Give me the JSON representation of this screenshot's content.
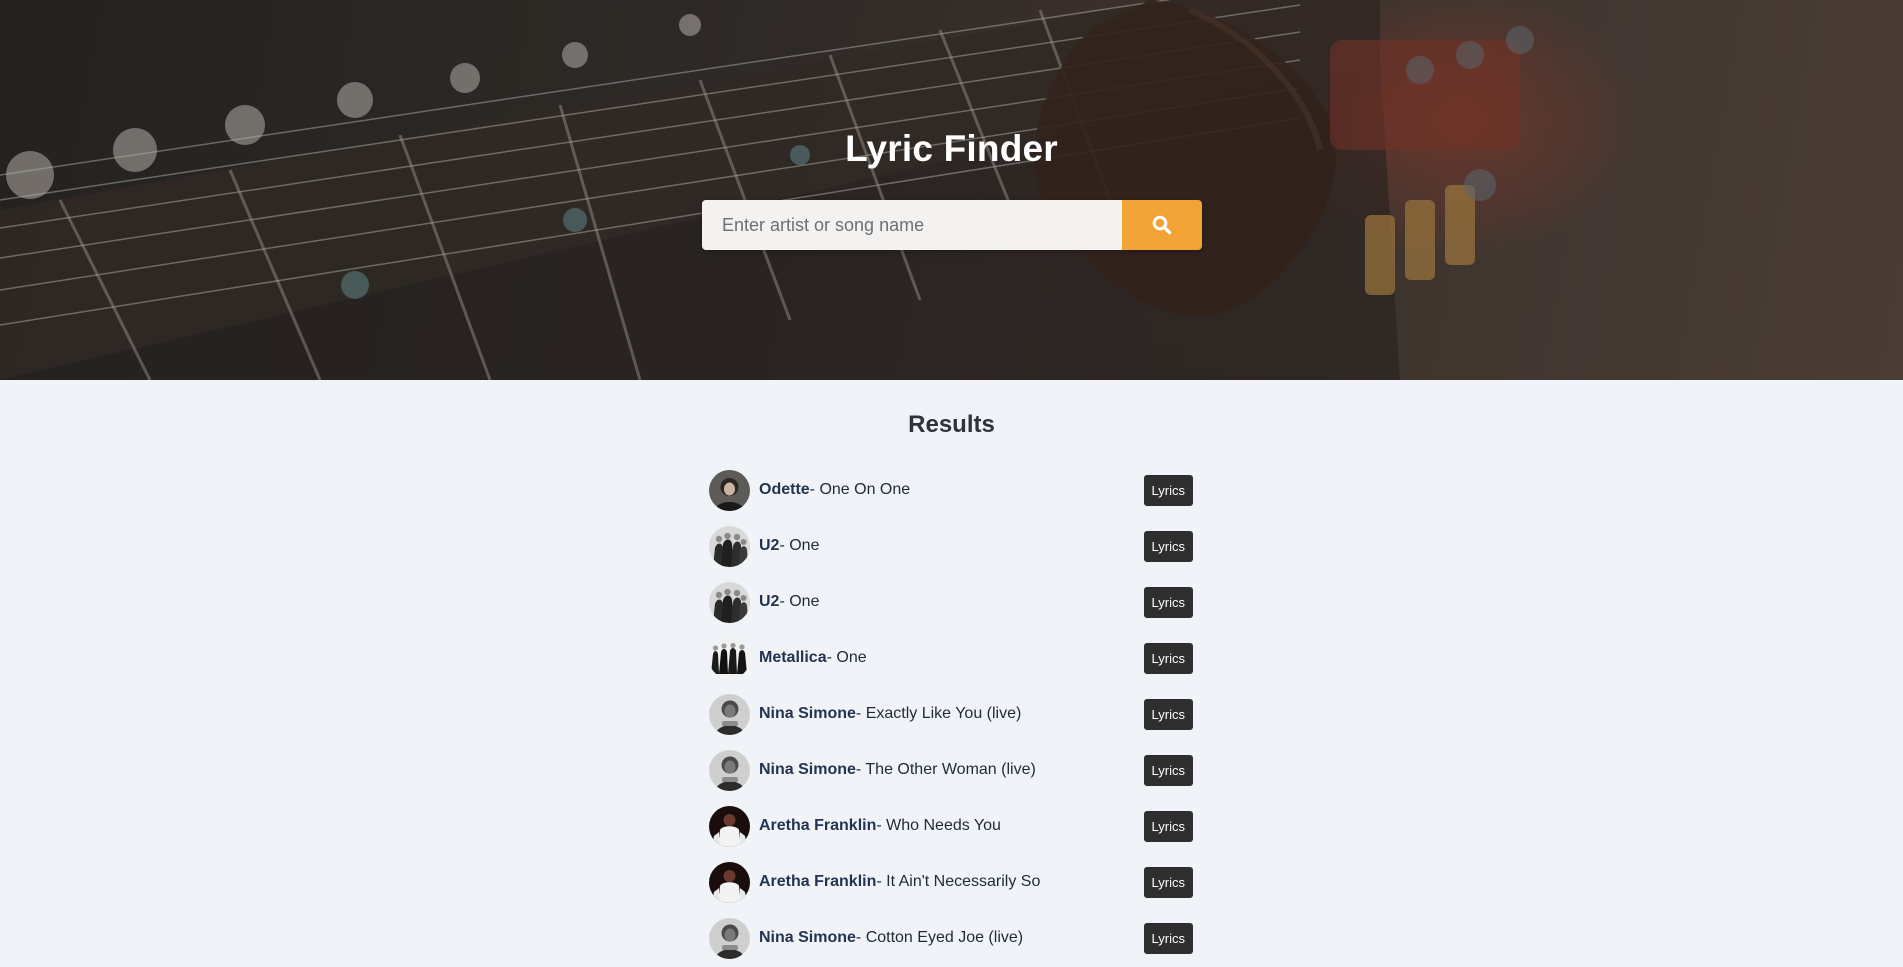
{
  "header": {
    "title": "Lyric Finder",
    "search": {
      "placeholder": "Enter artist or song name",
      "value": ""
    },
    "search_button_icon": "search-icon"
  },
  "colors": {
    "accent": "#f1a336",
    "page_bg": "#f0f4f9",
    "button_dark": "#2f2f2f",
    "artist_text": "#22344f"
  },
  "results": {
    "heading": "Results",
    "items": [
      {
        "artist": "Odette",
        "separator": "- ",
        "song": "One On One",
        "button": "Lyrics"
      },
      {
        "artist": "U2",
        "separator": "- ",
        "song": "One",
        "button": "Lyrics"
      },
      {
        "artist": "U2",
        "separator": "- ",
        "song": "One",
        "button": "Lyrics"
      },
      {
        "artist": "Metallica",
        "separator": "- ",
        "song": "One",
        "button": "Lyrics"
      },
      {
        "artist": "Nina Simone",
        "separator": "- ",
        "song": "Exactly Like You (live)",
        "button": "Lyrics"
      },
      {
        "artist": "Nina Simone",
        "separator": "- ",
        "song": "The Other Woman (live)",
        "button": "Lyrics"
      },
      {
        "artist": "Aretha Franklin",
        "separator": "- ",
        "song": "Who Needs You",
        "button": "Lyrics"
      },
      {
        "artist": "Aretha Franklin",
        "separator": "- ",
        "song": "It Ain't Necessarily So",
        "button": "Lyrics"
      },
      {
        "artist": "Nina Simone",
        "separator": "- ",
        "song": "Cotton Eyed Joe (live)",
        "button": "Lyrics"
      }
    ]
  }
}
